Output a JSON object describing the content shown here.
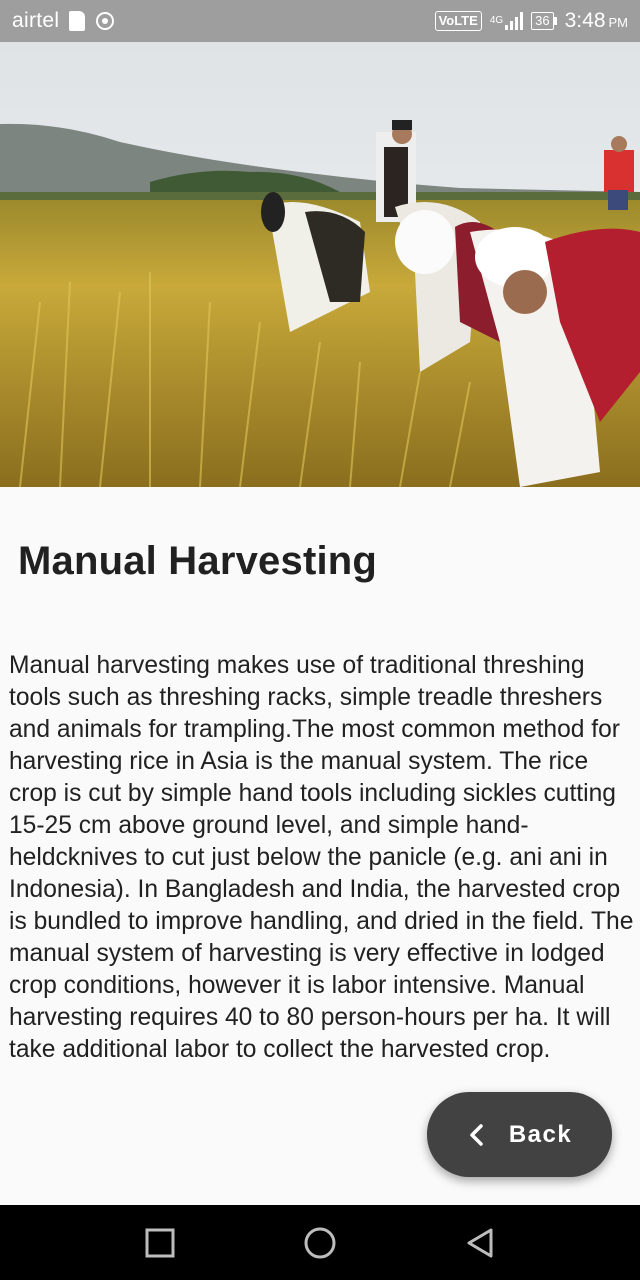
{
  "status_bar": {
    "carrier": "airtel",
    "volte": "VoLTE",
    "network": "4G",
    "battery": "36",
    "time": "3:48",
    "ampm": "PM"
  },
  "hero_image": {
    "icon": "rice-harvest-photo"
  },
  "article": {
    "title": "Manual Harvesting",
    "body": "Manual harvesting makes use of traditional threshing tools such as threshing racks, simple treadle threshers and animals for trampling.The most common method for harvesting rice in Asia is the manual system. The rice crop is cut by simple hand tools including sickles cutting 15-25 cm above ground level, and simple hand-heldcknives to cut just below the panicle (e.g. ani ani in Indonesia). In Bangladesh and India, the harvested crop is bundled to improve handling, and dried in the field. The manual system of harvesting is very effective in lodged crop conditions, however it is labor intensive. Manual harvesting requires 40 to 80 person-hours per ha. It will take additional labor to collect the harvested crop."
  },
  "back_button": {
    "label": "Back",
    "icon": "chevron-left-icon"
  },
  "nav_bar": {
    "recents_icon": "square-icon",
    "home_icon": "circle-icon",
    "back_icon": "triangle-back-icon"
  },
  "colors": {
    "status_bar": "#9e9e9e",
    "fab": "#424242",
    "text": "#212121",
    "nav_bar": "#000000"
  }
}
